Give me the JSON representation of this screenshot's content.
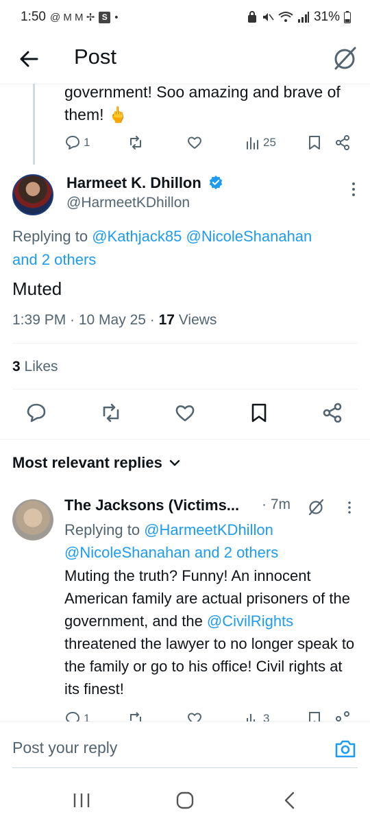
{
  "status_bar": {
    "time": "1:50",
    "notif_icons": "@ M M ✢",
    "s_badge": "S",
    "dot": "•",
    "battery": "31%"
  },
  "header": {
    "title": "Post"
  },
  "prev_tweet": {
    "text": "government!  Soo amazing and brave of them!  🖕",
    "reply_count": "1",
    "view_count": "25"
  },
  "tweet": {
    "author_name": "Harmeet K. Dhillon",
    "author_handle": "@HarmeetKDhillon",
    "replying_prefix": "Replying to ",
    "replying_users": "@Kathjack85 @NicoleShanahan",
    "replying_others": "and 2 others",
    "text": "Muted",
    "time_date": "1:39 PM · 10 May 25 · ",
    "views_count": "17",
    "views_label": " Views",
    "likes_count": "3",
    "likes_label": " Likes"
  },
  "replies_section": {
    "sort_label": "Most relevant replies"
  },
  "reply": {
    "author_name": "The Jacksons (Victims...",
    "time": "· 7m",
    "replying_prefix": "Replying to ",
    "replying_user1": "@HarmeetKDhillon",
    "replying_user2": "@NicoleShanahan and 2 others",
    "text_part1": "Muting the truth? Funny!  An innocent American family are actual prisoners of the government, and the ",
    "mention": "@CivilRights",
    "text_part2": " threatened the lawyer to no longer speak to the family or go to his office!   Civil rights at its finest!",
    "reply_count": "1",
    "view_count": "3"
  },
  "composer": {
    "placeholder": "Post your reply"
  },
  "colors": {
    "link": "#1d9bf0",
    "secondary_text": "#536471",
    "primary_text": "#0f1419"
  }
}
